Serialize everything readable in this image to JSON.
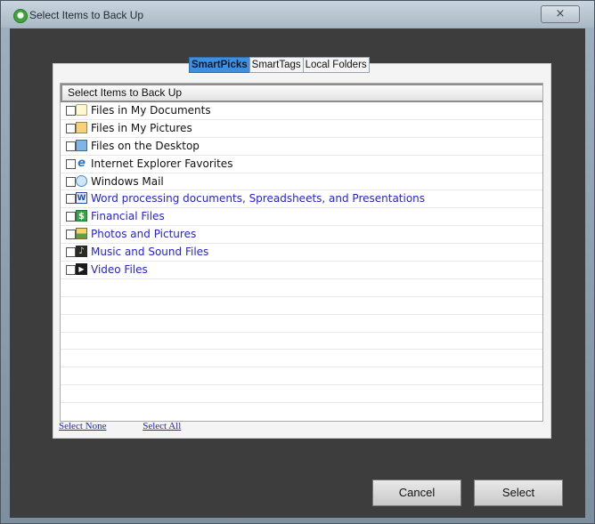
{
  "window": {
    "title": "Select Items to Back Up",
    "close_label": "×"
  },
  "tabs": [
    {
      "label": "SmartPicks",
      "active": true
    },
    {
      "label": "SmartTags",
      "active": false
    },
    {
      "label": "Local Folders",
      "active": false
    }
  ],
  "list": {
    "header": "Select Items to Back Up",
    "items": [
      {
        "label": "Files in My Documents",
        "icon": "documents-folder-icon",
        "glyph": "",
        "color": "black"
      },
      {
        "label": "Files in My Pictures",
        "icon": "pictures-folder-icon",
        "glyph": "",
        "color": "black"
      },
      {
        "label": "Files on the Desktop",
        "icon": "desktop-icon",
        "glyph": "",
        "color": "black"
      },
      {
        "label": "Internet Explorer Favorites",
        "icon": "internet-explorer-icon",
        "glyph": "e",
        "color": "black"
      },
      {
        "label": "Windows Mail",
        "icon": "windows-mail-icon",
        "glyph": "",
        "color": "black"
      },
      {
        "label": "Word processing documents, Spreadsheets, and Presentations",
        "icon": "word-document-icon",
        "glyph": "W",
        "color": "blue"
      },
      {
        "label": "Financial Files",
        "icon": "dollar-icon",
        "glyph": "$",
        "color": "blue"
      },
      {
        "label": "Photos and Pictures",
        "icon": "photo-icon",
        "glyph": "",
        "color": "blue"
      },
      {
        "label": "Music and Sound Files",
        "icon": "music-icon",
        "glyph": "♪",
        "color": "blue"
      },
      {
        "label": "Video Files",
        "icon": "video-icon",
        "glyph": "▶",
        "color": "blue"
      }
    ],
    "empty_rows": 7
  },
  "links": {
    "select_none": "Select None",
    "select_all": "Select All"
  },
  "buttons": {
    "cancel": "Cancel",
    "select": "Select"
  }
}
